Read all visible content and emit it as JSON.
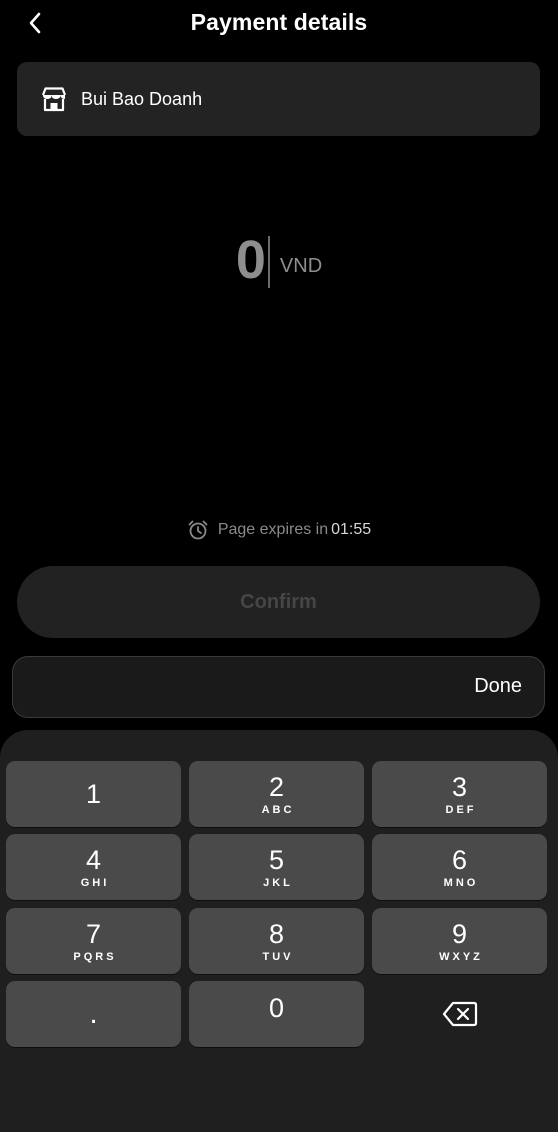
{
  "header": {
    "title": "Payment details"
  },
  "merchant": {
    "name": "Bui Bao Doanh"
  },
  "amount": {
    "value": "0",
    "currency": "VND"
  },
  "expiry": {
    "label": "Page expires in",
    "time": "01:55"
  },
  "confirm": {
    "label": "Confirm"
  },
  "accessory": {
    "done_label": "Done"
  },
  "keypad": {
    "keys": [
      {
        "digit": "1",
        "letters": ""
      },
      {
        "digit": "2",
        "letters": "ABC"
      },
      {
        "digit": "3",
        "letters": "DEF"
      },
      {
        "digit": "4",
        "letters": "GHI"
      },
      {
        "digit": "5",
        "letters": "JKL"
      },
      {
        "digit": "6",
        "letters": "MNO"
      },
      {
        "digit": "7",
        "letters": "PQRS"
      },
      {
        "digit": "8",
        "letters": "TUV"
      },
      {
        "digit": "9",
        "letters": "WXYZ"
      },
      {
        "digit": "."
      },
      {
        "digit": "0"
      }
    ]
  }
}
